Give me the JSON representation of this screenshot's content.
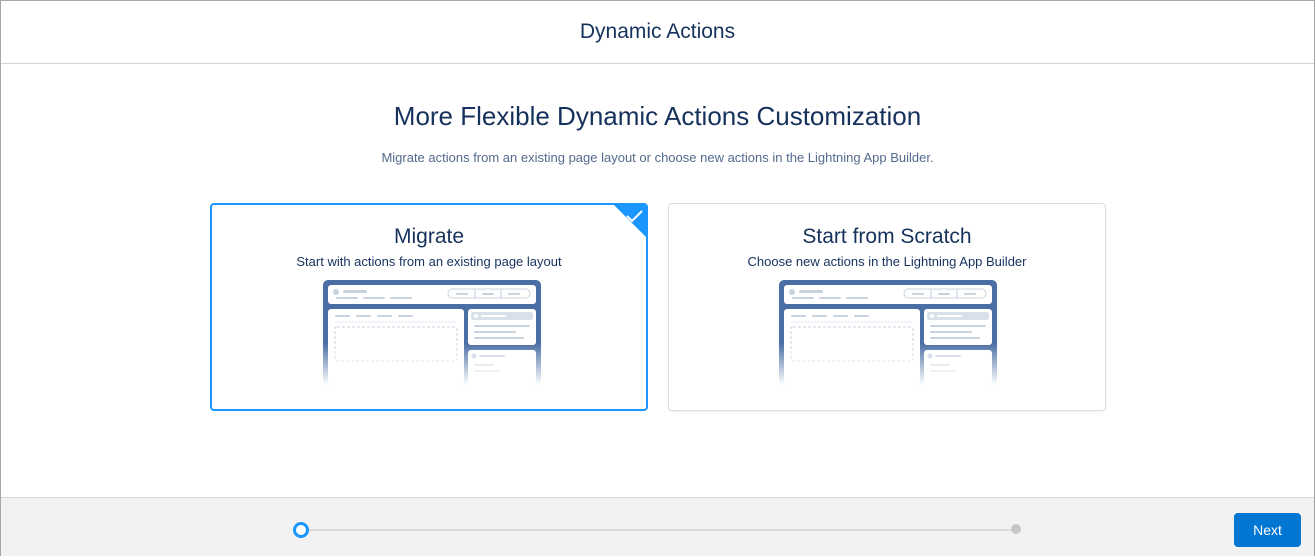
{
  "modal": {
    "title": "Dynamic Actions"
  },
  "content": {
    "heading": "More Flexible Dynamic Actions Customization",
    "subtext": "Migrate actions from an existing page layout or choose new actions in the Lightning App Builder.",
    "options": [
      {
        "title": "Migrate",
        "description": "Start with actions from an existing page layout",
        "selected": true,
        "icon": "check-icon"
      },
      {
        "title": "Start from Scratch",
        "description": "Choose new actions in the Lightning App Builder",
        "selected": false
      }
    ]
  },
  "footer": {
    "progress": {
      "current_step": 1,
      "total_steps": 2
    },
    "next_label": "Next"
  },
  "colors": {
    "accent": "#1b96ff",
    "brand_button": "#0176d3",
    "heading_text": "#16325c",
    "illustration_frame": "#4a6fa5"
  }
}
